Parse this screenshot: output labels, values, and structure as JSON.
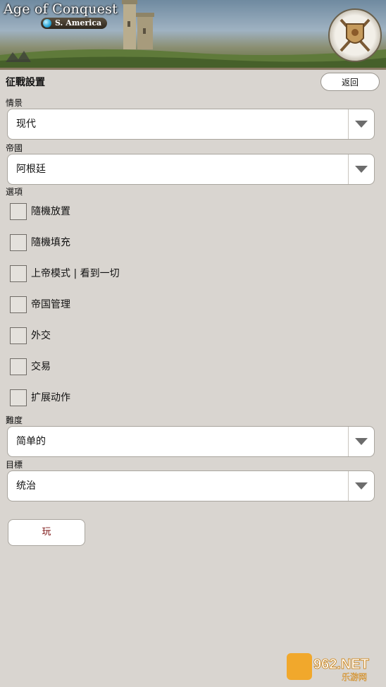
{
  "banner": {
    "game_title": "Age of Conquest",
    "region": "S. America"
  },
  "header": {
    "title": "征戰設置",
    "back_label": "返回"
  },
  "scenario": {
    "label": "情景",
    "value": "现代"
  },
  "empire": {
    "label": "帝國",
    "value": "阿根廷"
  },
  "options": {
    "label": "選項",
    "items": [
      {
        "label": "隨機放置",
        "checked": false
      },
      {
        "label": "隨機填充",
        "checked": false
      },
      {
        "label": "上帝模式 | 看到一切",
        "checked": false
      },
      {
        "label": "帝国管理",
        "checked": false
      },
      {
        "label": "外交",
        "checked": false
      },
      {
        "label": "交易",
        "checked": false
      },
      {
        "label": "扩展动作",
        "checked": false
      }
    ]
  },
  "difficulty": {
    "label": "難度",
    "value": "简单的"
  },
  "goal": {
    "label": "目標",
    "value": "统治"
  },
  "play_label": "玩",
  "watermark": {
    "brand": "962.NET",
    "sub": "乐游网"
  },
  "colors": {
    "background": "#d9d5d0",
    "play_text": "#7a1010"
  }
}
